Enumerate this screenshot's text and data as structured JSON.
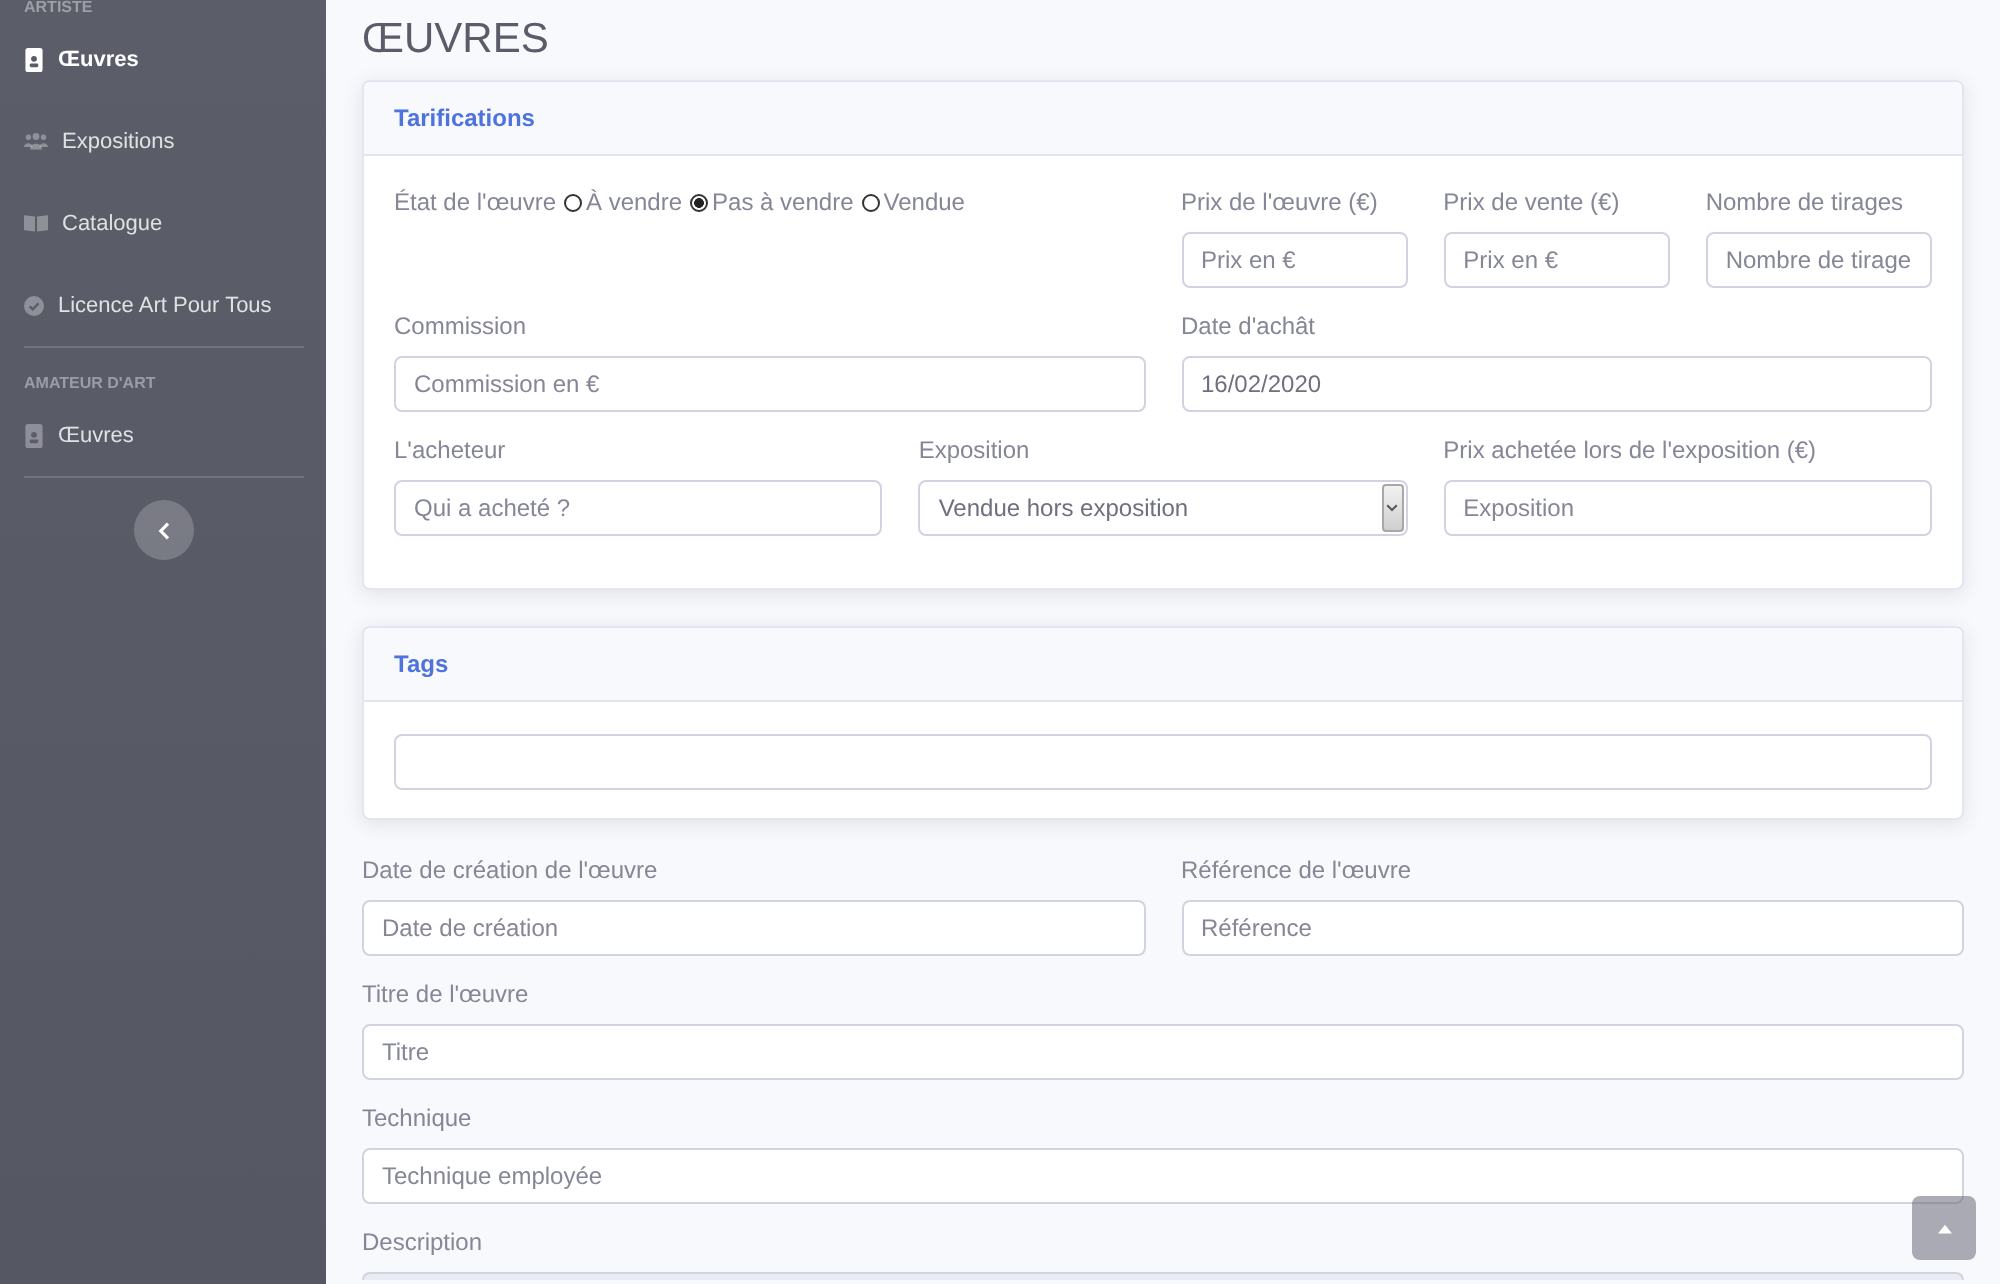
{
  "sidebar": {
    "sections": [
      {
        "heading": "ARTISTE",
        "items": [
          {
            "label": "Œuvres",
            "selected": true
          },
          {
            "label": "Expositions",
            "selected": false
          },
          {
            "label": "Catalogue",
            "selected": false
          },
          {
            "label": "Licence Art Pour Tous",
            "selected": false
          }
        ]
      },
      {
        "heading": "AMATEUR D'ART",
        "items": [
          {
            "label": "Œuvres",
            "selected": false
          }
        ]
      }
    ]
  },
  "page_title": "ŒUVRES",
  "cards": [
    {
      "title": "Tarifications",
      "rows": [
        [
          {
            "kind": "radios",
            "label": "État de l'œuvre",
            "options": [
              {
                "label": "À vendre",
                "selected": false
              },
              {
                "label": "Pas à vendre",
                "selected": true
              },
              {
                "label": "Vendue",
                "selected": false
              }
            ]
          },
          {
            "kind": "group",
            "fields": [
              {
                "kind": "input",
                "label": "Prix de l'œuvre (€)",
                "placeholder": "Prix en €"
              },
              {
                "kind": "input",
                "label": "Prix de vente (€)",
                "placeholder": "Prix en €"
              },
              {
                "kind": "input",
                "label": "Nombre de tirages",
                "placeholder": "Nombre de tirage"
              }
            ]
          }
        ],
        [
          {
            "kind": "input",
            "label": "Commission",
            "placeholder": "Commission en €"
          },
          {
            "kind": "input",
            "label": "Date d'achât",
            "value": "16/02/2020"
          }
        ],
        [
          {
            "kind": "input",
            "label": "L'acheteur",
            "placeholder": "Qui a acheté ?"
          },
          {
            "kind": "select",
            "label": "Exposition",
            "value": "Vendue hors exposition"
          },
          {
            "kind": "input",
            "label": "Prix achetée lors de l'exposition (€)",
            "placeholder": "Exposition"
          }
        ]
      ]
    },
    {
      "title": "Tags",
      "rows": [
        [
          {
            "kind": "input"
          }
        ]
      ]
    }
  ],
  "form": {
    "rows": [
      [
        {
          "kind": "input",
          "label": "Date de création de l'œuvre",
          "placeholder": "Date de création"
        },
        {
          "kind": "input",
          "label": "Référence de l'œuvre",
          "placeholder": "Référence"
        }
      ],
      [
        {
          "kind": "input",
          "label": "Titre de l'œuvre",
          "placeholder": "Titre"
        }
      ],
      [
        {
          "kind": "input",
          "label": "Technique",
          "placeholder": "Technique employée"
        }
      ],
      [
        {
          "kind": "textarea",
          "label": "Description"
        }
      ]
    ]
  }
}
